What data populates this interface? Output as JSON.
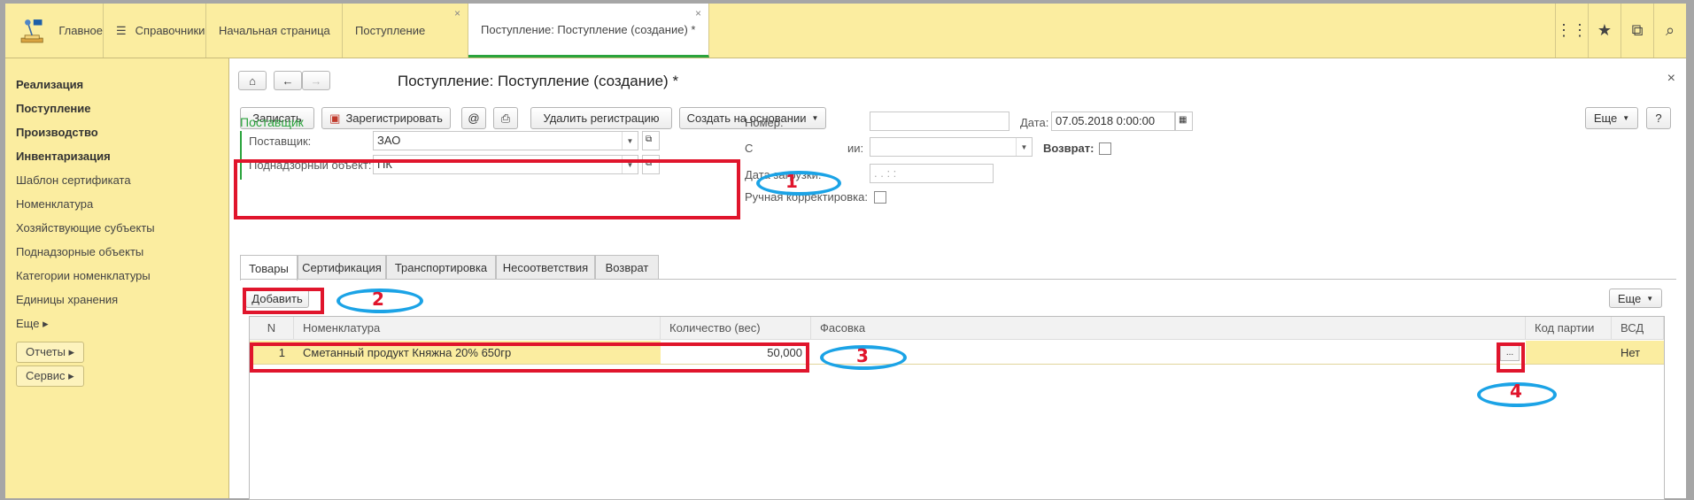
{
  "topbar": {
    "tabs": [
      {
        "label": "Главное"
      },
      {
        "label": "Справочники"
      },
      {
        "label": "Начальная страница"
      },
      {
        "label": "Поступление",
        "close": "×"
      },
      {
        "label": "Поступление: Поступление (создание) *",
        "close": "×"
      }
    ],
    "right_icons": [
      "apps-grid-icon",
      "star-icon",
      "history-icon",
      "search-icon"
    ]
  },
  "sidebar": {
    "items": [
      {
        "label": "Реализация",
        "bold": true
      },
      {
        "label": "Поступление",
        "bold": true
      },
      {
        "label": "Производство",
        "bold": true
      },
      {
        "label": "Инвентаризация",
        "bold": true
      },
      {
        "label": "Шаблон сертификата"
      },
      {
        "label": "Номенклатура"
      },
      {
        "label": "Хозяйствующие субъекты"
      },
      {
        "label": "Поднадзорные объекты"
      },
      {
        "label": "Категории номенклатуры"
      },
      {
        "label": "Единицы хранения"
      },
      {
        "label": "Еще ▸"
      }
    ],
    "buttons": [
      "Отчеты ▸",
      "Сервис ▸"
    ]
  },
  "form": {
    "title": "Поступление: Поступление (создание) *",
    "close": "×",
    "toolbar": {
      "write": "Записать",
      "register": "Зарегистрировать",
      "at": "@",
      "delete_reg": "Удалить регистрацию",
      "create_based": "Создать на основании",
      "more": "Еще",
      "help": "?"
    },
    "section_title": "Поставщик",
    "supplier_label": "Поставщик:",
    "supplier_value": "ЗАО",
    "object_label": "Поднадзорный объект:",
    "object_value": "ПК",
    "number_label": "Номер:",
    "number_value": "",
    "date_label": "Дата:",
    "date_value": "07.05.2018  0:00:00",
    "partial_label_left": "С",
    "partial_label_right": "ии:",
    "return_label": "Возврат:",
    "load_date_label": "Дата загрузки:",
    "load_date_value": ".  .      :  :",
    "manual_label": "Ручная корректировка:"
  },
  "tabs": [
    "Товары",
    "Сертификация",
    "Транспортировка",
    "Несоответствия",
    "Возврат"
  ],
  "table_toolbar": {
    "add": "Добавить",
    "more": "Еще"
  },
  "table": {
    "headers": [
      "N",
      "Номенклатура",
      "Количество (вес)",
      "Фасовка",
      "Код партии",
      "ВСД"
    ],
    "rows": [
      {
        "n": "1",
        "item": "Сметанный продукт Княжна 20% 650гр",
        "qty": "50,000",
        "pack": "",
        "pick": "...",
        "lot": "",
        "vsd": "Нет"
      }
    ]
  },
  "annotations": [
    "1",
    "2",
    "3",
    "4"
  ],
  "colors": {
    "highlight_red": "#e0152c",
    "ellipse_blue": "#1ba3e6",
    "panel_yellow": "#fbeda0",
    "active_green": "#2aa33c"
  }
}
